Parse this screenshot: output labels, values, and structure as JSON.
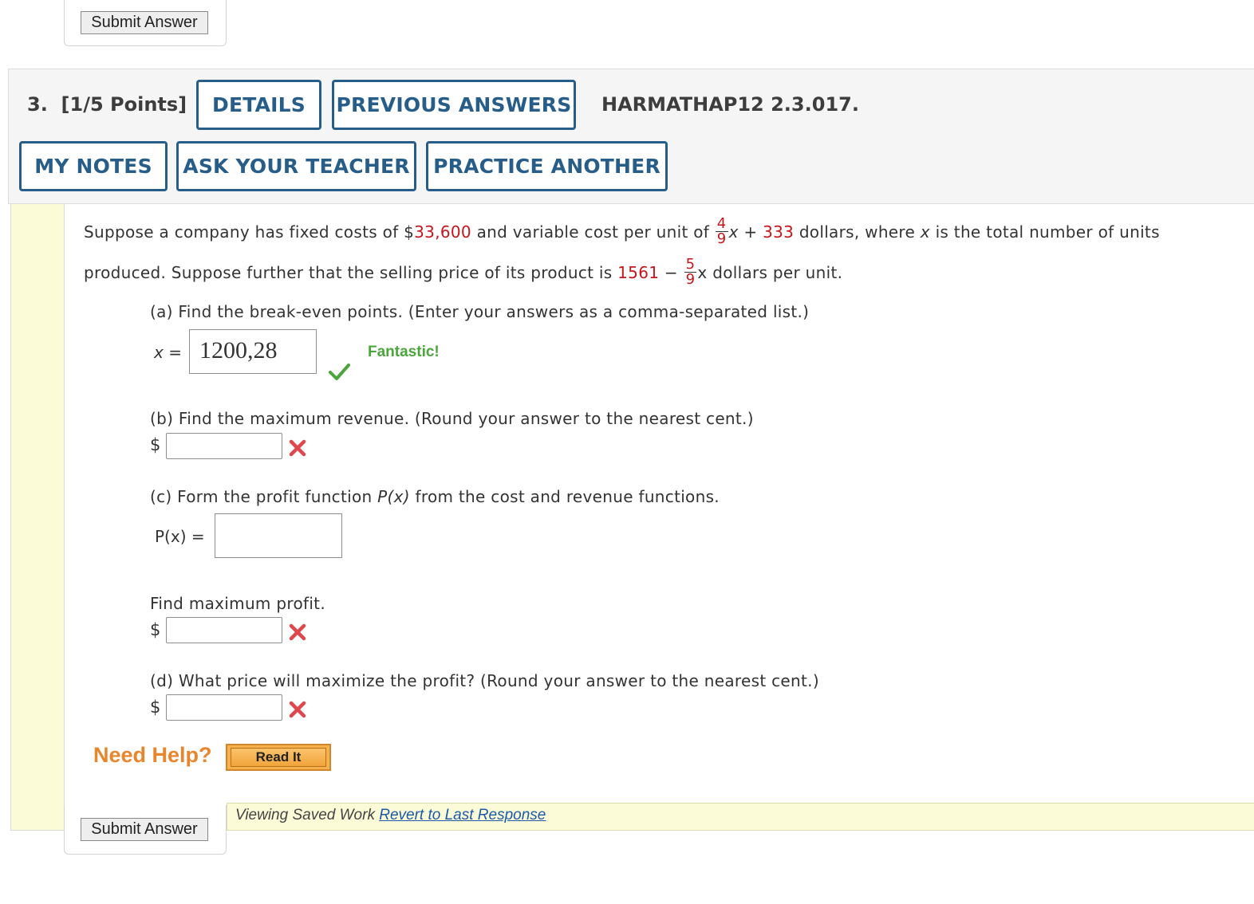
{
  "top_submit": {
    "label": "Submit Answer"
  },
  "question": {
    "number": "3.",
    "points": "[1/5 Points]",
    "buttons": {
      "details": "DETAILS",
      "previous_answers": "PREVIOUS ANSWERS",
      "my_notes": "MY NOTES",
      "ask_teacher": "ASK YOUR TEACHER",
      "practice_another": "PRACTICE ANOTHER"
    },
    "code": "HARMATHAP12 2.3.017."
  },
  "problem": {
    "l1_a": "Suppose a company has fixed costs of $",
    "fixed_cost": "33,600",
    "l1_b": " and variable cost per unit of ",
    "frac1_num": "4",
    "frac1_den": "9",
    "l1_c": "x + ",
    "var_const": "333",
    "l1_d": " dollars,  where ",
    "l1_x": "x",
    "l1_e": " is the total number of units",
    "l2_a": "produced. Suppose further that the selling price of its product is ",
    "price_const": "1561",
    "l2_b": " − ",
    "frac2_num": "5",
    "frac2_den": "9",
    "l2_c": "x dollars per unit."
  },
  "parts": {
    "a": {
      "prompt": "(a) Find the break-even points. (Enter your answers as a comma-separated list.)",
      "var_label": "x =",
      "answer": "1200,28",
      "feedback": "Fantastic!"
    },
    "b": {
      "prompt": "(b) Find the maximum revenue. (Round your answer to the nearest cent.)",
      "prefix": "$",
      "answer": ""
    },
    "c": {
      "prompt_a": "(c) Form the profit function ",
      "prompt_fn": "P(x)",
      "prompt_b": " from the cost and revenue functions.",
      "label": "P(x)  =",
      "answer": ""
    },
    "c2": {
      "prompt": "Find maximum profit.",
      "prefix": "$",
      "answer": ""
    },
    "d": {
      "prompt": "(d) What price will maximize the profit? (Round your answer to the nearest cent.)",
      "prefix": "$",
      "answer": ""
    }
  },
  "help": {
    "label": "Need Help?",
    "read_it": "Read It"
  },
  "saved": {
    "text": "Viewing Saved Work ",
    "link": "Revert to Last Response"
  },
  "bottom_submit": {
    "label": "Submit Answer"
  },
  "colors": {
    "accent_blue": "#275d89",
    "value_red": "#c4161c",
    "correct_green": "#4aa53a",
    "wrong_red": "#e0474c",
    "help_orange": "#e8862d"
  }
}
